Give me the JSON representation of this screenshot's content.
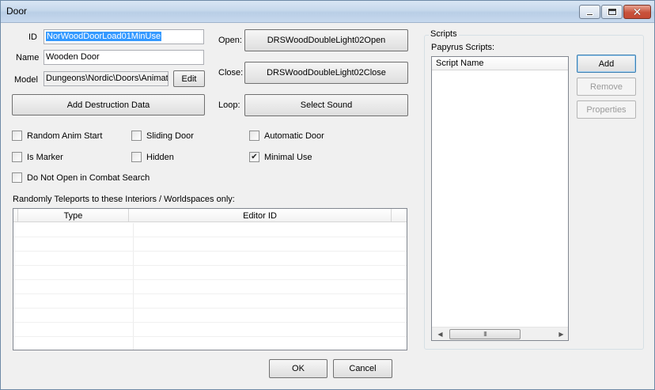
{
  "window": {
    "title": "Door",
    "minimize_glyph": "",
    "maximize_glyph": "",
    "close_glyph": "✕"
  },
  "form": {
    "id_label": "ID",
    "id_value": "NorWoodDoorLoad01MinUse",
    "name_label": "Name",
    "name_value": "Wooden Door",
    "model_label": "Model",
    "model_value": "Dungeons\\Nordic\\Doors\\Animat",
    "edit_label": "Edit",
    "add_destruction_label": "Add Destruction Data",
    "open_label": "Open:",
    "open_value": "DRSWoodDoubleLight02Open",
    "close_label": "Close:",
    "close_value": "DRSWoodDoubleLight02Close",
    "loop_label": "Loop:",
    "loop_value": "Select Sound"
  },
  "checkboxes": [
    {
      "label": "Random Anim Start",
      "checked": false
    },
    {
      "label": "Sliding Door",
      "checked": false
    },
    {
      "label": "Automatic Door",
      "checked": false
    },
    {
      "label": "Is Marker",
      "checked": false
    },
    {
      "label": "Hidden",
      "checked": false
    },
    {
      "label": "Minimal Use",
      "checked": true
    },
    {
      "label": "Do Not Open in Combat Search",
      "checked": false
    }
  ],
  "teleports": {
    "caption": "Randomly Teleports to these Interiors / Worldspaces only:",
    "columns": [
      "Type",
      "Editor ID"
    ]
  },
  "scripts": {
    "group_title": "Scripts",
    "caption": "Papyrus Scripts:",
    "column": "Script Name",
    "add_label": "Add",
    "remove_label": "Remove",
    "properties_label": "Properties",
    "scroll_thumb_glyph": "III",
    "scroll_left_glyph": "◀",
    "scroll_right_glyph": "▶"
  },
  "footer": {
    "ok_label": "OK",
    "cancel_label": "Cancel"
  }
}
